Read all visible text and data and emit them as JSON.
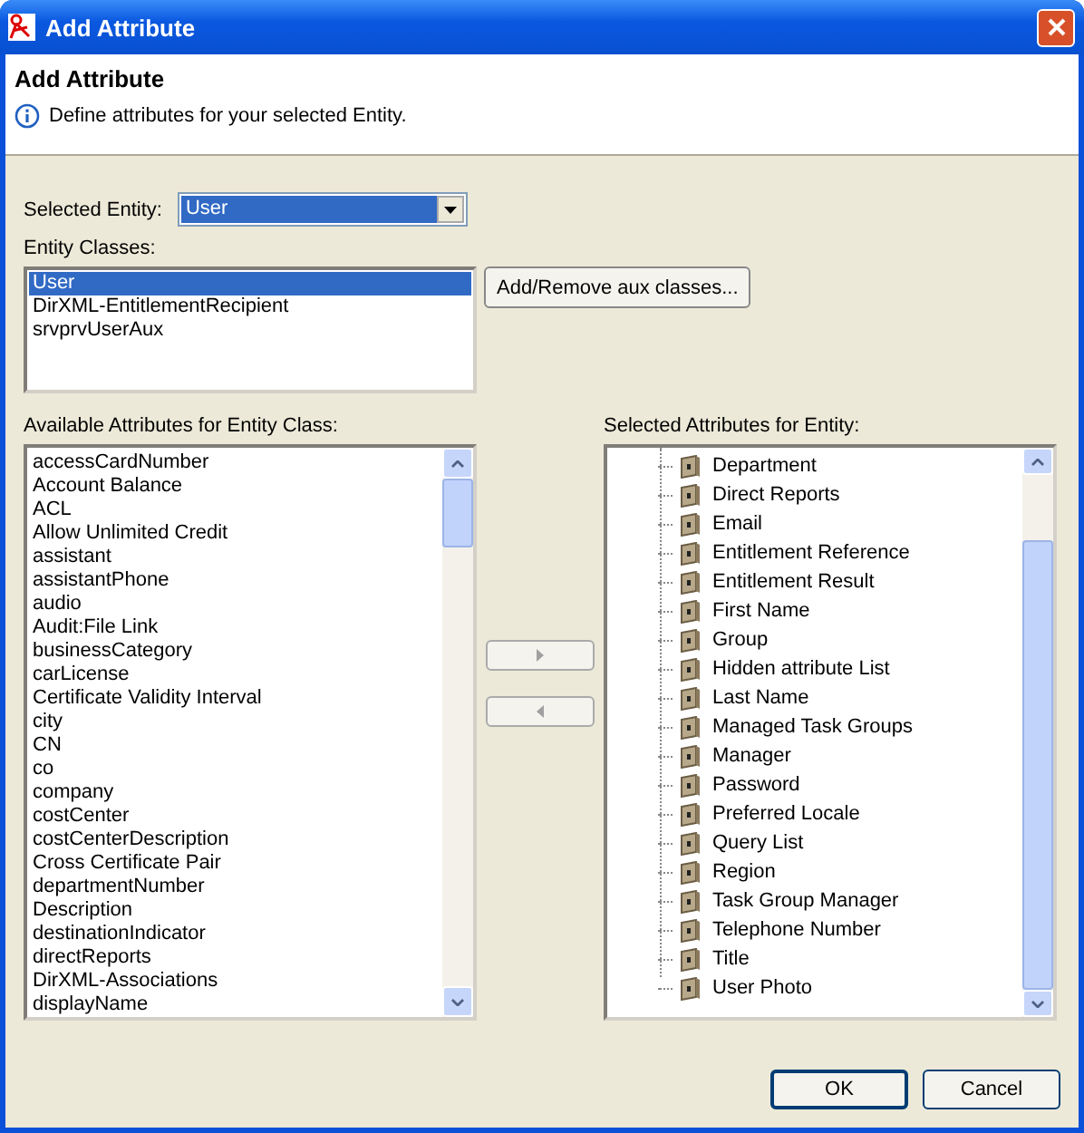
{
  "window": {
    "title": "Add Attribute"
  },
  "header": {
    "title": "Add Attribute",
    "message": "Define attributes for your selected Entity."
  },
  "selected_entity": {
    "label": "Selected Entity:",
    "value": "User"
  },
  "entity_classes": {
    "label": "Entity Classes:",
    "items": [
      {
        "label": "User",
        "selected": true
      },
      {
        "label": "DirXML-EntitlementRecipient",
        "selected": false
      },
      {
        "label": "srvprvUserAux",
        "selected": false
      }
    ],
    "button": "Add/Remove aux classes..."
  },
  "available": {
    "label": "Available Attributes for Entity Class:",
    "items": [
      {
        "label": "accessCardNumber",
        "selected": false
      },
      {
        "label": "Account Balance",
        "selected": false
      },
      {
        "label": "ACL",
        "selected": false
      },
      {
        "label": "Allow Unlimited Credit",
        "selected": false
      },
      {
        "label": "assistant",
        "selected": false
      },
      {
        "label": "assistantPhone",
        "selected": false
      },
      {
        "label": "audio",
        "selected": false
      },
      {
        "label": "Audit:File Link",
        "selected": false
      },
      {
        "label": "businessCategory",
        "selected": false
      },
      {
        "label": "carLicense",
        "selected": false
      },
      {
        "label": "Certificate Validity Interval",
        "selected": false
      },
      {
        "label": "city",
        "selected": false
      },
      {
        "label": "CN",
        "selected": false
      },
      {
        "label": "co",
        "selected": false
      },
      {
        "label": "company",
        "selected": false
      },
      {
        "label": "costCenter",
        "selected": false
      },
      {
        "label": "costCenterDescription",
        "selected": false
      },
      {
        "label": "Cross Certificate Pair",
        "selected": false
      },
      {
        "label": "departmentNumber",
        "selected": false
      },
      {
        "label": "Description",
        "selected": false
      },
      {
        "label": "destinationIndicator",
        "selected": false
      },
      {
        "label": "directReports",
        "selected": false
      },
      {
        "label": "DirXML-Associations",
        "selected": false
      },
      {
        "label": "displayName",
        "selected": false
      }
    ]
  },
  "move_buttons": [
    {
      "kind": "add",
      "disabled": true
    },
    {
      "kind": "remove",
      "disabled": true
    }
  ],
  "selected_attributes": {
    "label": "Selected Attributes for Entity:",
    "items": [
      {
        "label": "Department",
        "selected": false
      },
      {
        "label": "Direct Reports",
        "selected": false
      },
      {
        "label": "Email",
        "selected": false
      },
      {
        "label": "Entitlement Reference",
        "selected": false
      },
      {
        "label": "Entitlement Result",
        "selected": false
      },
      {
        "label": "First Name",
        "selected": false
      },
      {
        "label": "Group",
        "selected": false
      },
      {
        "label": "Hidden attribute List",
        "selected": false
      },
      {
        "label": "Last Name",
        "selected": false
      },
      {
        "label": "Managed Task Groups",
        "selected": false
      },
      {
        "label": "Manager",
        "selected": false
      },
      {
        "label": "Password",
        "selected": false
      },
      {
        "label": "Preferred Locale",
        "selected": false
      },
      {
        "label": "Query List",
        "selected": false
      },
      {
        "label": "Region",
        "selected": false
      },
      {
        "label": "Task Group Manager",
        "selected": false
      },
      {
        "label": "Telephone Number",
        "selected": false
      },
      {
        "label": "Title",
        "selected": false
      },
      {
        "label": "User Photo",
        "selected": false
      }
    ]
  },
  "buttons": [
    "OK",
    "Cancel"
  ]
}
